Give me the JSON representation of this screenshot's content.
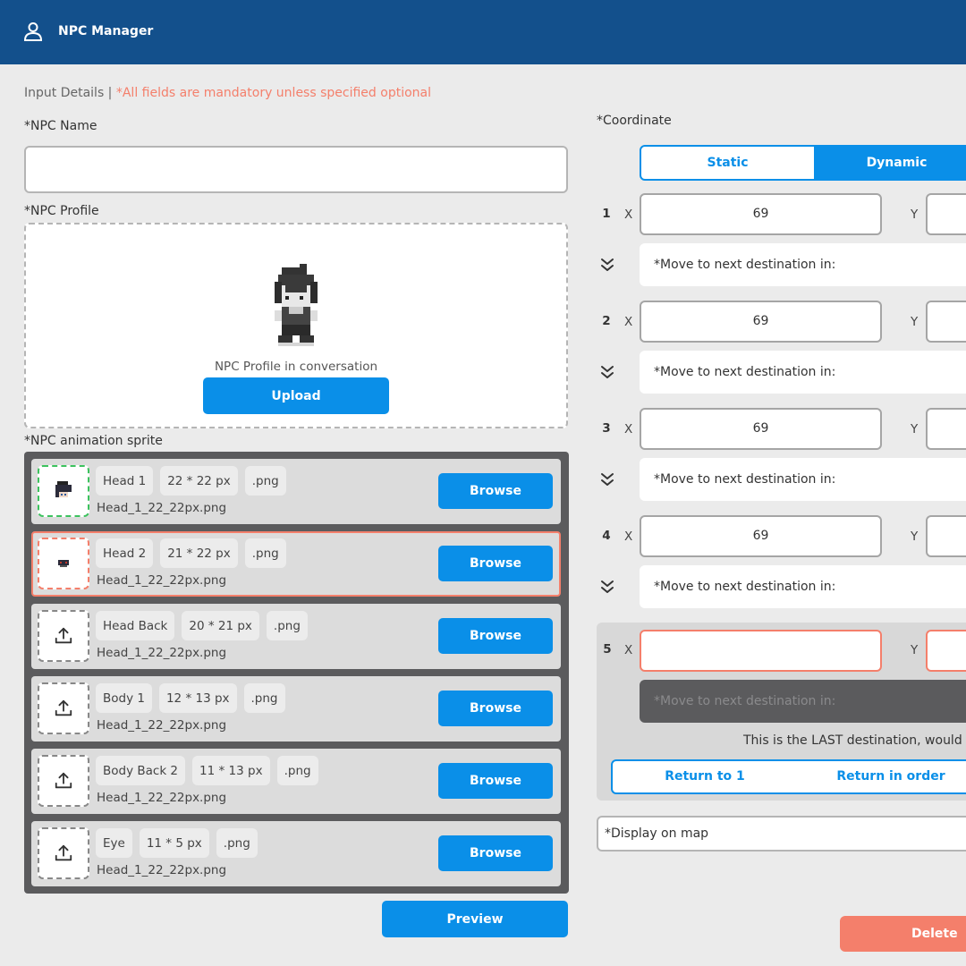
{
  "header": {
    "title": "NPC Manager",
    "icon": "user-icon"
  },
  "intro": {
    "label": "Input Details |",
    "note": "*All fields are mandatory unless specified optional"
  },
  "npc_name": {
    "label": "*NPC Name",
    "value": ""
  },
  "npc_profile": {
    "label": "*NPC Profile",
    "caption": "NPC Profile in conversation",
    "upload_label": "Upload"
  },
  "sprite": {
    "label": "*NPC animation sprite",
    "browse_label": "Browse",
    "rows": [
      {
        "part": "Head 1",
        "size": "22 * 22 px",
        "ext": ".png",
        "file": "Head_1_22_22px.png"
      },
      {
        "part": "Head 2",
        "size": "21 * 22 px",
        "ext": ".png",
        "file": "Head_1_22_22px.png"
      },
      {
        "part": "Head Back",
        "size": "20 * 21 px",
        "ext": ".png",
        "file": "Head_1_22_22px.png"
      },
      {
        "part": "Body 1",
        "size": "12 * 13 px",
        "ext": ".png",
        "file": "Head_1_22_22px.png"
      },
      {
        "part": "Body Back 2",
        "size": "11 * 13 px",
        "ext": ".png",
        "file": "Head_1_22_22px.png"
      },
      {
        "part": "Eye",
        "size": "11 * 5 px",
        "ext": ".png",
        "file": "Head_1_22_22px.png"
      }
    ]
  },
  "preview_label": "Preview",
  "coordinate": {
    "label": "*Coordinate",
    "modes": {
      "static": "Static",
      "dynamic": "Dynamic"
    },
    "x_label": "X",
    "y_label": "Y",
    "move_label": "*Move to next destination in:",
    "points": [
      {
        "num": "1",
        "x": "69"
      },
      {
        "num": "2",
        "x": "69"
      },
      {
        "num": "3",
        "x": "69"
      },
      {
        "num": "4",
        "x": "69"
      },
      {
        "num": "5",
        "x": ""
      }
    ],
    "last_note": "This is the LAST destination, would",
    "return_to_1": "Return to 1",
    "return_in_order": "Return in order"
  },
  "display_on_map": "*Display on map",
  "delete_label": "Delete",
  "colors": {
    "header": "#13508c",
    "accent": "#0a8fe8",
    "danger": "#f47f6b",
    "success": "#3cc25e"
  }
}
